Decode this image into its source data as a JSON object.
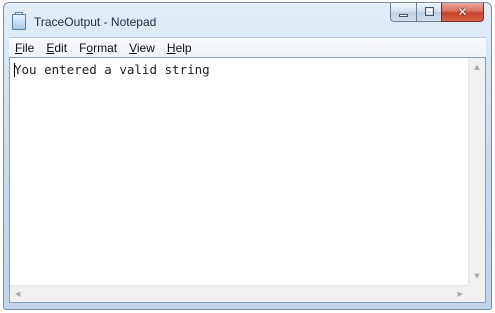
{
  "window": {
    "title": "TraceOutput - Notepad",
    "icon": "notepad-icon",
    "close_glyph": "✕"
  },
  "menu": [
    {
      "prefix": "",
      "mnemonic": "F",
      "rest": "ile"
    },
    {
      "prefix": "",
      "mnemonic": "E",
      "rest": "dit"
    },
    {
      "prefix": "F",
      "mnemonic": "o",
      "rest": "rmat"
    },
    {
      "prefix": "",
      "mnemonic": "V",
      "rest": "iew"
    },
    {
      "prefix": "",
      "mnemonic": "H",
      "rest": "elp"
    }
  ],
  "editor": {
    "content": "You entered a valid string"
  },
  "scrollbars": {
    "up": "▲",
    "down": "▼",
    "left": "◀",
    "right": "▶"
  },
  "colors": {
    "title_text": "#1e2c3e",
    "close_button": "#c5432d",
    "frame": "#c7d8ec"
  }
}
